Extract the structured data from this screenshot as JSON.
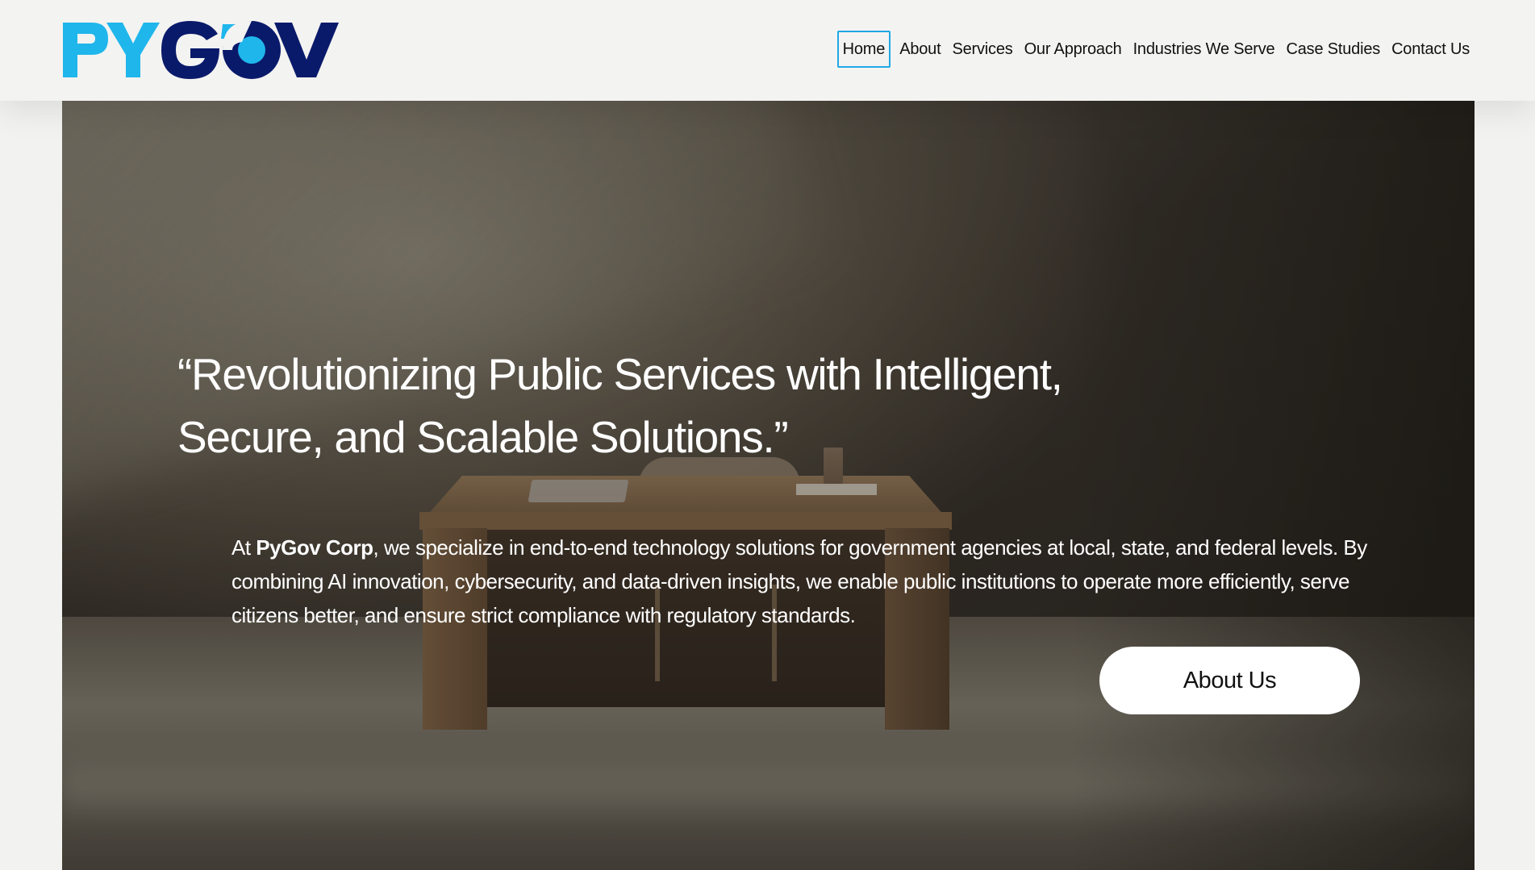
{
  "brand": {
    "logo_text": "PYGOV",
    "logo_colors": {
      "cyan": "#1fb6ec",
      "navy": "#0a1a6b"
    }
  },
  "nav": {
    "items": [
      {
        "label": "Home",
        "active": true
      },
      {
        "label": "About",
        "active": false
      },
      {
        "label": "Services",
        "active": false
      },
      {
        "label": "Our Approach",
        "active": false
      },
      {
        "label": "Industries We Serve",
        "active": false
      },
      {
        "label": "Case Studies",
        "active": false
      },
      {
        "label": "Contact Us",
        "active": false
      }
    ],
    "active_border_color": "#1fa8e6"
  },
  "hero": {
    "headline": "“Revolutionizing Public Services with Intelligent, Secure, and Scalable Solutions.”",
    "intro_prefix": "At ",
    "intro_company": "PyGov Corp",
    "intro_body": ", we specialize in end-to-end technology solutions for government agencies at local, state, and federal levels. By combining AI innovation, cybersecurity, and data-driven insights, we enable public institutions to operate more efficiently, serve citizens better, and ensure strict compliance with regulatory standards.",
    "cta_label": "About Us",
    "background_image": "office-desk-photo"
  }
}
